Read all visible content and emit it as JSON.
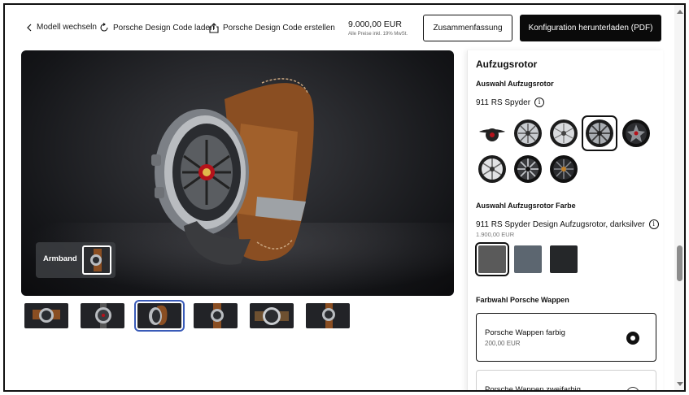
{
  "header": {
    "change_model": "Modell wechseln",
    "load_code": "Porsche Design Code laden",
    "create_code": "Porsche Design Code erstellen",
    "price": "9.000,00 EUR",
    "price_note": "Alle Preise inkl. 19% MwSt.",
    "summary_button": "Zusammenfassung",
    "download_button": "Konfiguration herunterladen (PDF)"
  },
  "viewer": {
    "armband_label": "Armband",
    "thumbnail_count": 6,
    "selected_thumbnail": 3
  },
  "panel": {
    "title": "Aufzugsrotor",
    "rotor_section": "Auswahl Aufzugsrotor",
    "rotor_selected": "911 RS Spyder",
    "rotor_options": [
      "winged-rotor",
      "wheel-rotor",
      "wheel-rotor",
      "wheel-rotor",
      "wheel-rotor",
      "wheel-rotor",
      "wheel-rotor",
      "wheel-rotor"
    ],
    "rotor_selected_index": 3,
    "color_section": "Auswahl Aufzugsrotor Farbe",
    "color_selected": "911 RS Spyder Design Aufzugsrotor, darksilver",
    "color_price": "1.900,00 EUR",
    "swatches": [
      "#5a5a5a",
      "#5c6670",
      "#252729"
    ],
    "swatch_selected_index": 0,
    "crest_section": "Farbwahl Porsche Wappen",
    "crest_options": [
      {
        "name": "Porsche Wappen farbig",
        "price": "200,00 EUR",
        "selected": true
      },
      {
        "name": "Porsche Wappen zweifarbig",
        "price": "",
        "selected": false
      }
    ]
  },
  "colors": {
    "primary": "#0a0a0a",
    "thumb_highlight": "#3a5bb8"
  }
}
